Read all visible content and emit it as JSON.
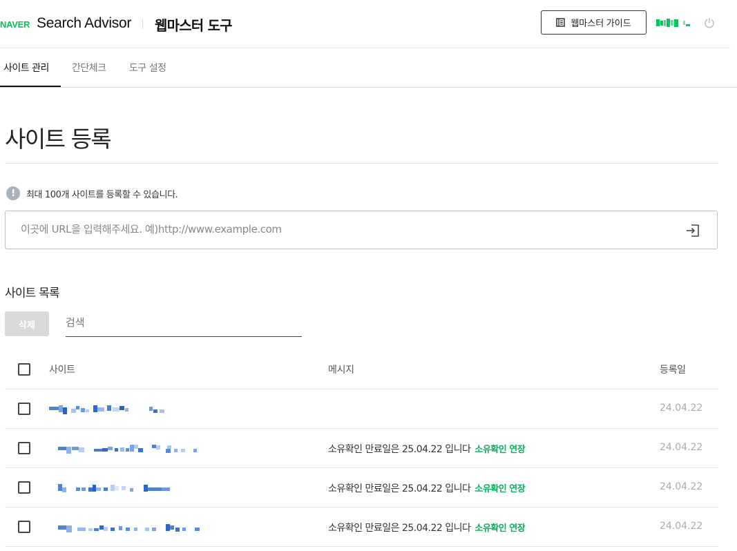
{
  "header": {
    "logo": "NAVER",
    "brand": "Search Advisor",
    "subtitle": "웹마스터 도구",
    "guide_button": "웹마스터 가이드",
    "user_name_redacted": true
  },
  "tabs": [
    {
      "label": "사이트 관리",
      "active": true
    },
    {
      "label": "간단체크",
      "active": false
    },
    {
      "label": "도구 설정",
      "active": false
    }
  ],
  "main": {
    "title": "사이트 등록",
    "notice": "최대 100개 사이트를 등록할 수 있습니다.",
    "url_placeholder": "이곳에 URL을 입력해주세요. 예)http://www.example.com",
    "list_title": "사이트 목록",
    "delete_button": "삭제",
    "search_placeholder": "검색"
  },
  "table": {
    "headers": {
      "site": "사이트",
      "message": "메시지",
      "date": "등록일"
    },
    "rows": [
      {
        "site": "redacted",
        "message": "",
        "link": "",
        "date": "24.04.22"
      },
      {
        "site": "redacted",
        "message": "소유확인 만료일은 25.04.22 입니다",
        "link": "소유확인 연장",
        "date": "24.04.22"
      },
      {
        "site": "redacted",
        "message": "소유확인 만료일은 25.04.22 입니다",
        "link": "소유확인 연장",
        "date": "24.04.22"
      },
      {
        "site": "redacted",
        "message": "소유확인 만료일은 25.04.22 입니다",
        "link": "소유확인 연장",
        "date": "24.04.22"
      }
    ]
  },
  "colors": {
    "brand_green": "#03c75a",
    "link_green": "#03b35a",
    "disabled_button": "#d9d9d9",
    "notice_icon": "#a9b2bb"
  },
  "icons": {
    "guide": "book-icon",
    "logout": "power-icon",
    "submit": "login-arrow-icon",
    "notice": "info-icon"
  }
}
